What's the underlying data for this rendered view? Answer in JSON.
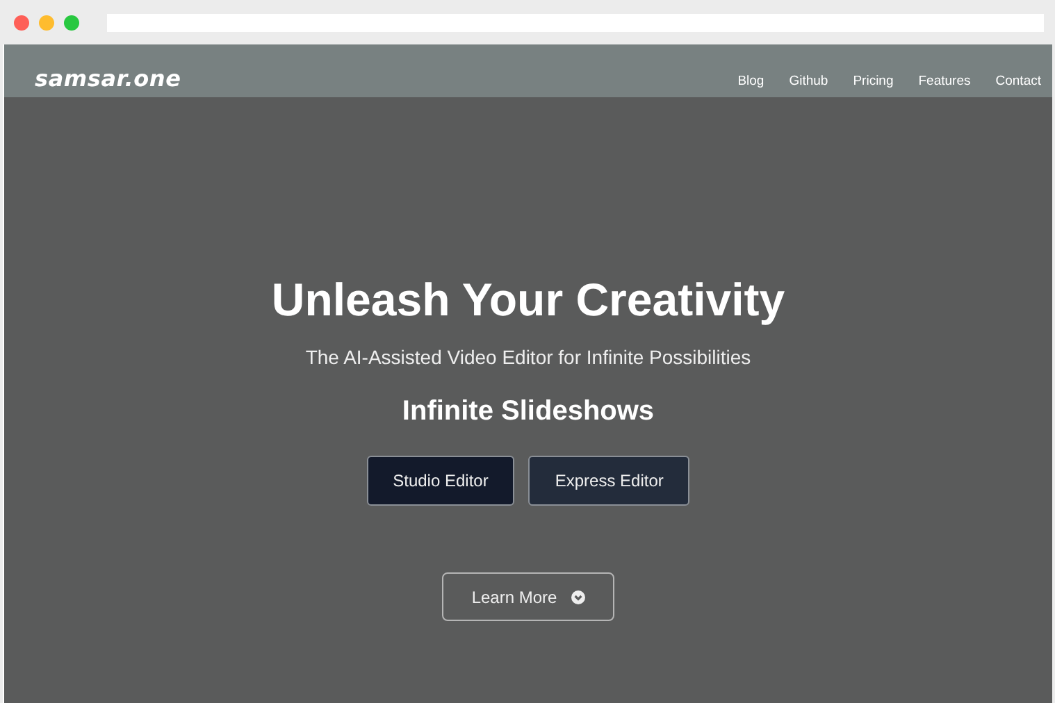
{
  "brand": "samsar.one",
  "nav": [
    {
      "label": "Blog"
    },
    {
      "label": "Github"
    },
    {
      "label": "Pricing"
    },
    {
      "label": "Features"
    },
    {
      "label": "Contact"
    }
  ],
  "hero": {
    "title": "Unleash Your Creativity",
    "subtitle": "The AI-Assisted Video Editor for Infinite Possibilities",
    "tagline": "Infinite Slideshows",
    "buttons": [
      {
        "label": "Studio Editor",
        "kind": "primary"
      },
      {
        "label": "Express Editor",
        "kind": "secondary"
      }
    ],
    "learn_more": "Learn More"
  }
}
